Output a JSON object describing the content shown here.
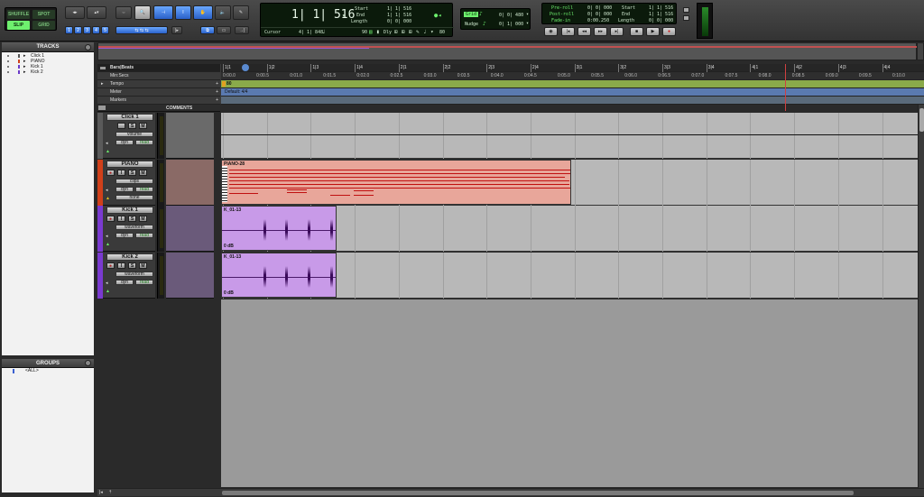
{
  "toolbar": {
    "modes": {
      "shuffle": "SHUFFLE",
      "spot": "SPOT",
      "slip": "SLIP",
      "grid": "GRID"
    },
    "zoom_presets": [
      "1",
      "2",
      "3",
      "4",
      "5"
    ],
    "main_counter": "1| 1| 516",
    "start_label": "Start",
    "start_value": "1| 1| 516",
    "end_label": "End",
    "end_value": "1| 1| 516",
    "length_label": "Length",
    "length_value": "0| 0| 000",
    "cursor_label": "Cursor",
    "cursor_value": "4| 1| 848",
    "cursor_extra": "90",
    "dly_label": "Dly",
    "tempo_value": "80",
    "grid_label": "Grid",
    "grid_value": "0| 0| 480",
    "nudge_label": "Nudge",
    "nudge_value": "0| 1| 000",
    "preroll_label": "Pre-roll",
    "preroll_value": "0| 0| 000",
    "postroll_label": "Post-roll",
    "postroll_value": "0| 0| 000",
    "fadein_label": "Fade-in",
    "fadein_value": "0:00.250",
    "start2_label": "Start",
    "start2_value": "1| 1| 516",
    "end2_label": "End",
    "end2_value": "1| 1| 516",
    "length2_label": "Length",
    "length2_value": "0| 0| 000"
  },
  "tracks_panel": {
    "title": "TRACKS",
    "items": [
      {
        "name": "Click 1",
        "color": "#555555"
      },
      {
        "name": "PIANO",
        "color": "#d0401a"
      },
      {
        "name": "Kick 1",
        "color": "#6a3ac8"
      },
      {
        "name": "Kick 2",
        "color": "#6a3ac8"
      }
    ]
  },
  "groups_panel": {
    "title": "GROUPS",
    "items": [
      "<ALL>"
    ]
  },
  "rulers": {
    "bars_beats": "Bars|Beats",
    "min_secs": "Min:Secs",
    "tempo": "Tempo",
    "meter": "Meter",
    "markers": "Markers",
    "tempo_marker": "80",
    "meter_marker": "Default: 4/4",
    "bar_ticks": [
      "1|1",
      "1|2",
      "1|3",
      "1|4",
      "2|1",
      "2|2",
      "2|3",
      "2|4",
      "3|1",
      "3|2",
      "3|3",
      "3|4",
      "4|1",
      "4|2",
      "4|3",
      "4|4"
    ],
    "sec_ticks": [
      "0:00.0",
      "0:00.5",
      "0:01.0",
      "0:01.5",
      "0:02.0",
      "0:02.5",
      "0:03.0",
      "0:03.5",
      "0:04.0",
      "0:04.5",
      "0:05.0",
      "0:05.5",
      "0:06.0",
      "0:06.5",
      "0:07.0",
      "0:07.5",
      "0:08.0",
      "0:08.5",
      "0:09.0",
      "0:09.5",
      "0:10.0"
    ]
  },
  "comments_header": "COMMENTS",
  "tracks": [
    {
      "name": "Click 1",
      "view": "volume",
      "dyn": "dyn",
      "mode": "read",
      "color": "#5a5a5a",
      "clip": null
    },
    {
      "name": "PIANO",
      "view": "clips",
      "dyn": "dyn",
      "mode": "read",
      "extra": "none",
      "color": "#d0401a",
      "clip": {
        "name": "PIANO-28",
        "color": "#e8a69a"
      }
    },
    {
      "name": "Kick 1",
      "view": "waveform",
      "dyn": "dyn",
      "mode": "read",
      "color": "#7a3ad0",
      "clip": {
        "name": "K_01-13",
        "gain": "0 dB",
        "color": "#c89ae8"
      }
    },
    {
      "name": "Kick 2",
      "view": "waveform",
      "dyn": "dyn",
      "mode": "read",
      "color": "#7a3ad0",
      "clip": {
        "name": "K_01-13",
        "gain": "0 dB",
        "color": "#c89ae8"
      }
    }
  ],
  "track_buttons": {
    "rec": "●",
    "input": "I",
    "solo": "S",
    "mute": "M"
  },
  "colors": {
    "lcd": "#0b1a0b",
    "lcd_green": "#6ef06e",
    "accent_blue": "#2a60c8",
    "piano": "#e8a69a",
    "kick": "#c89ae8"
  }
}
